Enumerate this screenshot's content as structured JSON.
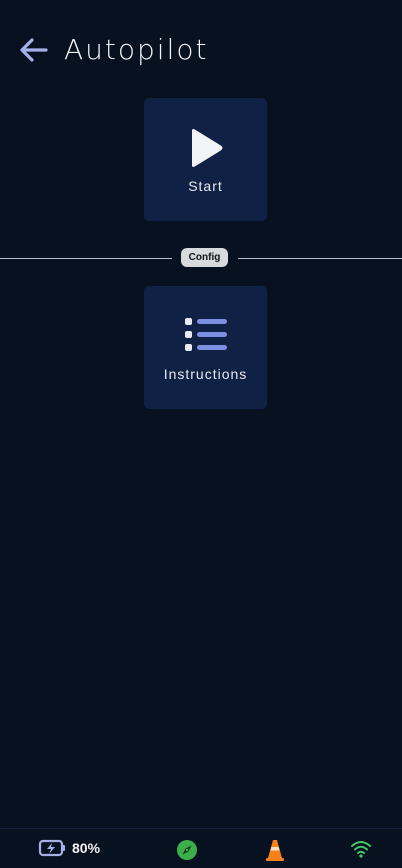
{
  "header": {
    "title": "Autopilot",
    "back_icon": "arrow-left-icon"
  },
  "tiles": {
    "start": {
      "label": "Start",
      "icon": "play-icon"
    },
    "instructions": {
      "label": "Instructions",
      "icon": "list-icon"
    }
  },
  "divider": {
    "label": "Config"
  },
  "statusbar": {
    "battery_percent": "80%",
    "battery_icon": "battery-charging-icon",
    "compass_icon": "compass-icon",
    "cone_icon": "traffic-cone-icon",
    "wifi_icon": "wifi-icon"
  },
  "colors": {
    "background": "#08111f",
    "tile": "#0f2144",
    "accent": "#a5b0ea",
    "list_icon": "#7c8fe0",
    "compass": "#3bb04a",
    "cone": "#f7821b",
    "wifi": "#44c767"
  }
}
